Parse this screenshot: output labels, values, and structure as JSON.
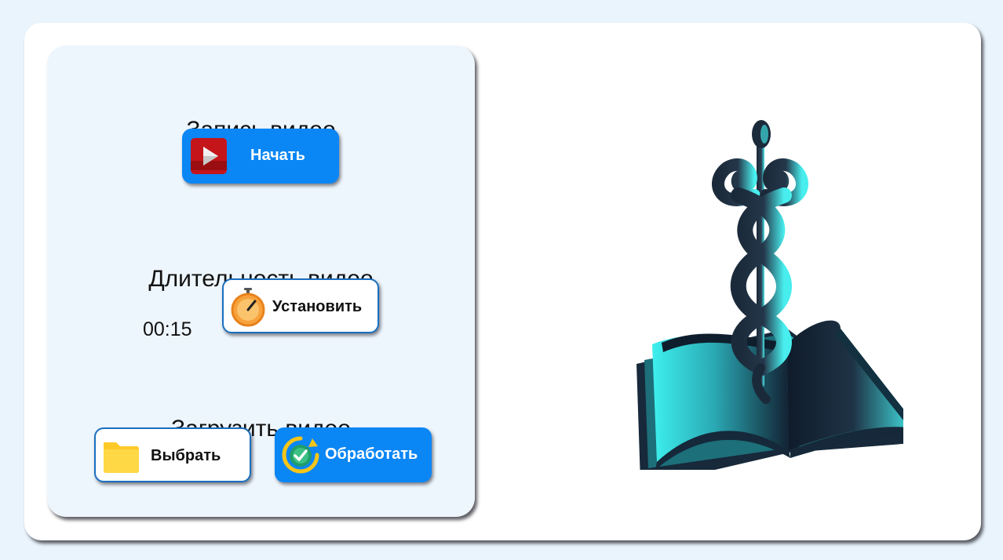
{
  "record": {
    "title": "Запись видео",
    "start_label": "Начать",
    "start_icon": "play-video-icon"
  },
  "duration": {
    "title": "Длительность видео",
    "value": "00:15",
    "set_label": "Установить",
    "set_icon": "stopwatch-icon"
  },
  "upload": {
    "title": "Загрузить видео",
    "choose_label": "Выбрать",
    "choose_icon": "folder-icon",
    "process_label": "Обработать",
    "process_icon": "process-check-icon"
  },
  "illustration": {
    "name": "caduceus-book-illustration"
  },
  "colors": {
    "page_background": "#eaf4fc",
    "card_background": "#ffffff",
    "panel_background": "#eef6fd",
    "primary_button": "#0a86f5",
    "secondary_border": "#1a6fbf",
    "illustration_dark": "#1b2a3a",
    "illustration_highlight": "#4ff2f0"
  }
}
